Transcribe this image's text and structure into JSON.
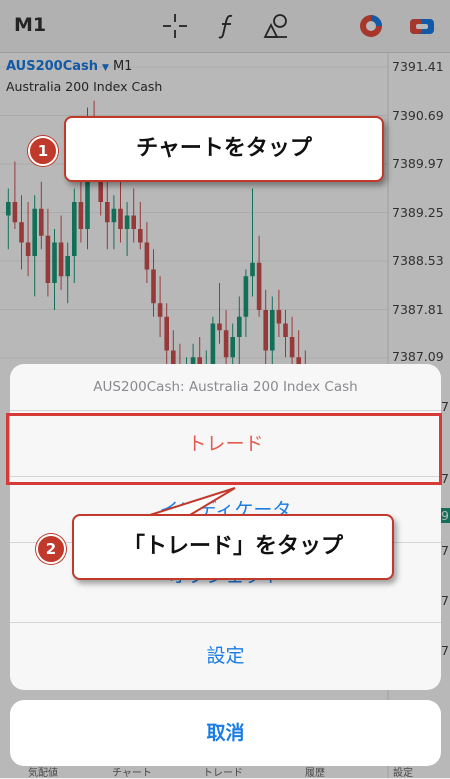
{
  "toolbar": {
    "timeframe": "M1",
    "icons": [
      "crosshair-icon",
      "indicator-f-icon",
      "objects-icon",
      "chart-color-icon",
      "account-icon"
    ]
  },
  "chart": {
    "symbol": "AUS200Cash",
    "timeframe": "M1",
    "description": "Australia 200 Index Cash",
    "yticks": [
      "7391.41",
      "7390.69",
      "7389.97",
      "7389.25",
      "7388.53",
      "7387.81",
      "7387.09"
    ],
    "partial_ticks": [
      "7",
      "7",
      "9",
      "7",
      "7",
      "7"
    ]
  },
  "chart_data": {
    "type": "candlestick",
    "ylim": [
      7386.6,
      7391.6
    ],
    "bull_color": "#1a9a7a",
    "bear_color": "#d05050",
    "candles": [
      [
        7389.4,
        7389.8,
        7388.9,
        7389.6
      ],
      [
        7389.6,
        7390.2,
        7389.2,
        7389.3
      ],
      [
        7389.3,
        7389.7,
        7388.6,
        7389.0
      ],
      [
        7389.0,
        7389.6,
        7388.5,
        7388.8
      ],
      [
        7388.8,
        7389.7,
        7388.2,
        7389.5
      ],
      [
        7389.5,
        7389.9,
        7388.9,
        7389.1
      ],
      [
        7389.1,
        7389.5,
        7388.2,
        7388.4
      ],
      [
        7388.4,
        7389.2,
        7388.0,
        7389.0
      ],
      [
        7389.0,
        7389.4,
        7388.3,
        7388.5
      ],
      [
        7388.5,
        7389.0,
        7388.1,
        7388.8
      ],
      [
        7388.8,
        7389.8,
        7388.4,
        7389.6
      ],
      [
        7389.6,
        7390.1,
        7389.0,
        7389.2
      ],
      [
        7389.2,
        7391.0,
        7388.9,
        7390.8
      ],
      [
        7390.8,
        7391.1,
        7390.0,
        7390.2
      ],
      [
        7390.2,
        7390.5,
        7389.4,
        7389.6
      ],
      [
        7389.6,
        7389.9,
        7388.9,
        7389.3
      ],
      [
        7389.3,
        7389.7,
        7388.9,
        7389.5
      ],
      [
        7389.5,
        7390.0,
        7389.0,
        7389.2
      ],
      [
        7389.2,
        7389.6,
        7388.8,
        7389.4
      ],
      [
        7389.4,
        7389.8,
        7389.0,
        7389.2
      ],
      [
        7389.2,
        7389.6,
        7388.9,
        7389.0
      ],
      [
        7389.0,
        7389.3,
        7388.4,
        7388.6
      ],
      [
        7388.6,
        7388.9,
        7387.9,
        7388.1
      ],
      [
        7388.1,
        7388.5,
        7387.6,
        7387.9
      ],
      [
        7387.9,
        7388.1,
        7387.2,
        7387.4
      ],
      [
        7387.4,
        7387.7,
        7386.9,
        7387.2
      ],
      [
        7387.2,
        7387.5,
        7386.8,
        7387.0
      ],
      [
        7387.0,
        7387.3,
        7386.7,
        7387.1
      ],
      [
        7387.1,
        7387.5,
        7386.9,
        7387.3
      ],
      [
        7387.3,
        7387.6,
        7387.0,
        7387.1
      ],
      [
        7387.1,
        7387.4,
        7386.8,
        7387.2
      ],
      [
        7387.2,
        7387.9,
        7387.0,
        7387.8
      ],
      [
        7387.8,
        7388.4,
        7387.5,
        7387.7
      ],
      [
        7387.7,
        7388.0,
        7387.1,
        7387.3
      ],
      [
        7387.3,
        7387.8,
        7387.0,
        7387.6
      ],
      [
        7387.6,
        7388.2,
        7387.2,
        7387.9
      ],
      [
        7387.9,
        7388.6,
        7387.6,
        7388.5
      ],
      [
        7388.5,
        7389.8,
        7388.2,
        7388.7
      ],
      [
        7388.7,
        7389.1,
        7387.9,
        7388.0
      ],
      [
        7388.0,
        7388.3,
        7387.2,
        7387.4
      ],
      [
        7387.4,
        7388.2,
        7387.1,
        7388.0
      ],
      [
        7388.0,
        7388.3,
        7387.6,
        7387.8
      ],
      [
        7387.8,
        7388.0,
        7387.3,
        7387.6
      ],
      [
        7387.6,
        7387.9,
        7387.1,
        7387.3
      ],
      [
        7387.3,
        7387.7,
        7386.9,
        7387.1
      ],
      [
        7387.1,
        7387.4,
        7386.7,
        7386.9
      ]
    ]
  },
  "sheet": {
    "title": "AUS200Cash: Australia 200 Index Cash",
    "items": [
      {
        "label": "トレード"
      },
      {
        "label": "インディケータ"
      },
      {
        "label": "オブジェクト"
      },
      {
        "label": "設定"
      }
    ],
    "cancel": "取消"
  },
  "bottom_tabs": [
    "気配値",
    "チャート",
    "トレード",
    "履歴",
    "設定"
  ],
  "annotations": {
    "callout1": {
      "num": "1",
      "text": "チャートをタップ"
    },
    "callout2": {
      "num": "2",
      "text": "「トレード」をタップ"
    },
    "highlight_color": "#d63b38"
  }
}
